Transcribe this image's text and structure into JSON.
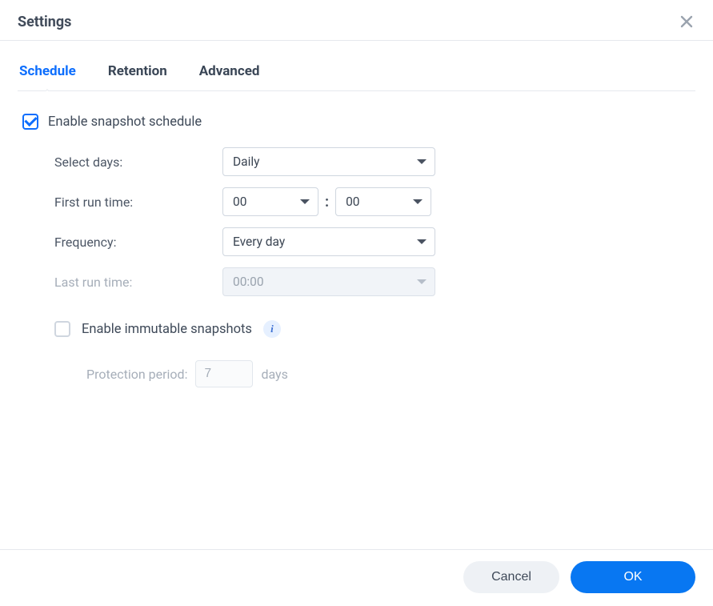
{
  "header": {
    "title": "Settings"
  },
  "tabs": [
    {
      "label": "Schedule",
      "active": true
    },
    {
      "label": "Retention",
      "active": false
    },
    {
      "label": "Advanced",
      "active": false
    }
  ],
  "schedule": {
    "enable_label": "Enable snapshot schedule",
    "enable_checked": true,
    "select_days": {
      "label": "Select days:",
      "value": "Daily"
    },
    "first_run": {
      "label": "First run time:",
      "hour": "00",
      "minute": "00"
    },
    "frequency": {
      "label": "Frequency:",
      "value": "Every day"
    },
    "last_run": {
      "label": "Last run time:",
      "value": "00:00",
      "disabled": true
    },
    "immutable": {
      "label": "Enable immutable snapshots",
      "checked": false,
      "protection": {
        "label": "Protection period:",
        "value": "7",
        "unit": "days",
        "disabled": true
      }
    }
  },
  "footer": {
    "cancel": "Cancel",
    "ok": "OK"
  }
}
